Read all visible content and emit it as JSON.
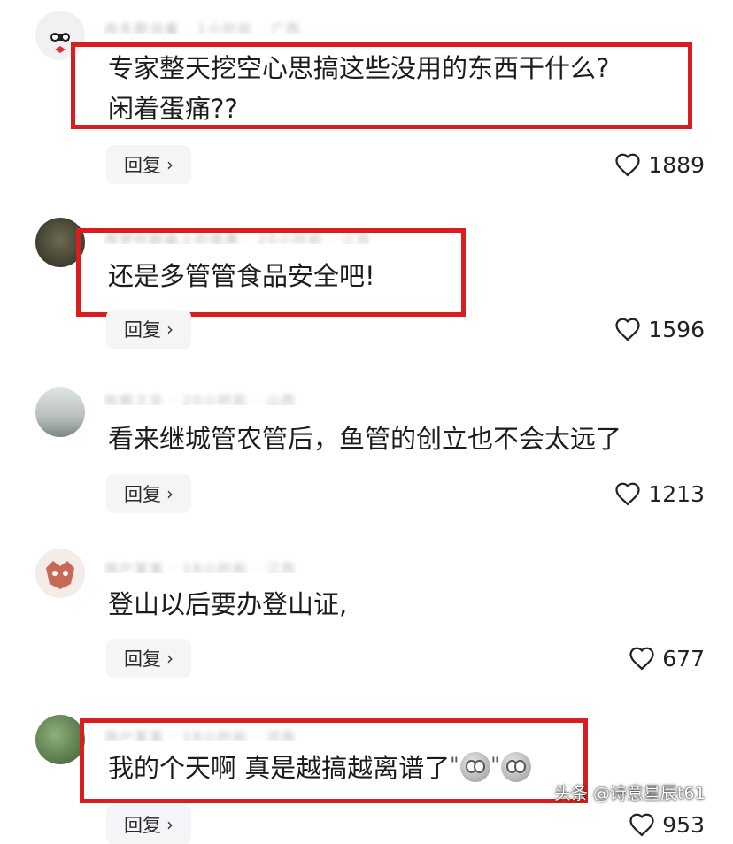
{
  "comments": [
    {
      "text_line1": "专家整天挖空心思搞这些没用的东西干什么?",
      "text_line2": "闲着蛋痛??",
      "reply_label": "回复",
      "likes": "1889"
    },
    {
      "text": "还是多管管食品安全吧!",
      "reply_label": "回复",
      "likes": "1596"
    },
    {
      "text": "看来继城管农管后，鱼管的创立也不会太远了",
      "reply_label": "回复",
      "likes": "1213"
    },
    {
      "text": "登山以后要办登山证,",
      "reply_label": "回复",
      "likes": "677"
    },
    {
      "text": "我的个天啊 真是越搞越离谱了",
      "reply_label": "回复",
      "likes": "953"
    }
  ],
  "watermark": "头条 @诗意星辰t61",
  "colors": {
    "highlight": "#d81e1e",
    "reply_bg": "#f4f5f7"
  },
  "icons": {
    "like": "heart-outline-icon",
    "reply_arrow": "chevron-right-icon",
    "emoji": "shocked-face-emoji-icon"
  }
}
